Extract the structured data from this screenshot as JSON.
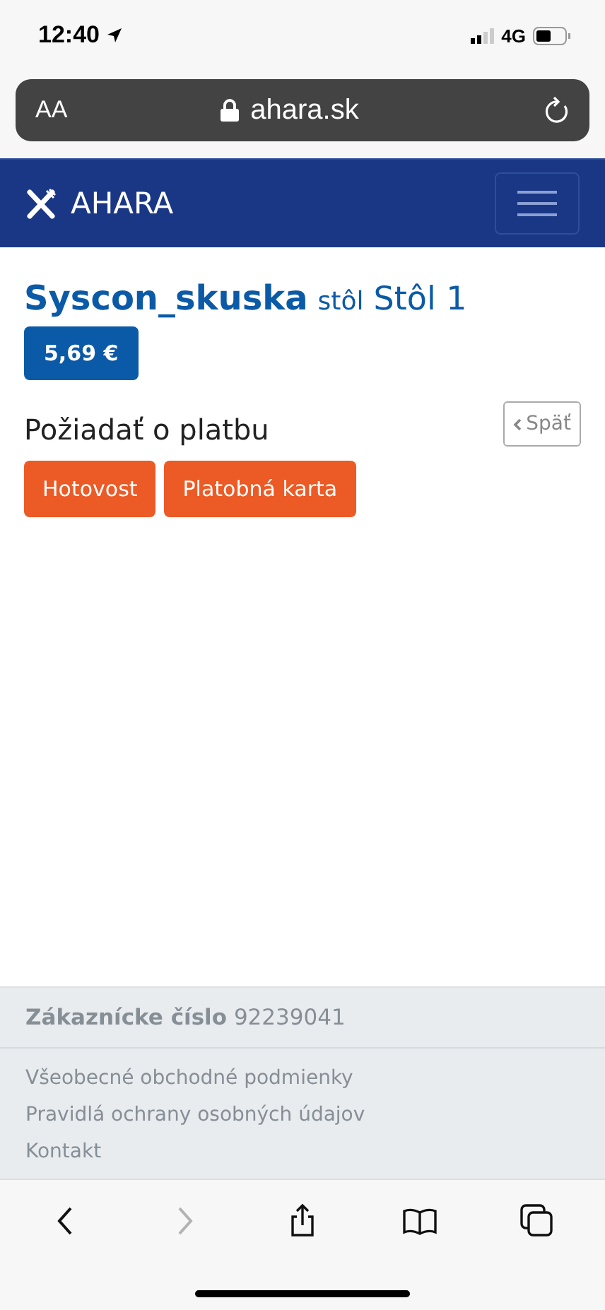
{
  "status_bar": {
    "time": "12:40",
    "network": "4G"
  },
  "address_bar": {
    "text_size": "AA",
    "url": "ahara.sk"
  },
  "navbar": {
    "brand": "AHARA"
  },
  "order": {
    "restaurant": "Syscon_skuska",
    "table_label": "stôl",
    "table": "Stôl 1",
    "total": "5,69 €"
  },
  "payment": {
    "title": "Požiadať o platbu",
    "back": "Späť",
    "options": [
      "Hotovost",
      "Platobná karta"
    ]
  },
  "footer": {
    "customer_number": "**Zákaznícke číslo** 92239041",
    "links": [
      "Všeobecné obchodné podmienky",
      "Pravidlá ochrany osobných údajov",
      "Kontakt"
    ]
  },
  "toolbar": [
    {
      "kind": "back",
      "disabled": false
    },
    {
      "kind": "forward",
      "disabled": true
    },
    {
      "kind": "share",
      "disabled": false
    },
    {
      "kind": "bookmarks",
      "disabled": false
    },
    {
      "kind": "tabs",
      "disabled": false
    }
  ]
}
